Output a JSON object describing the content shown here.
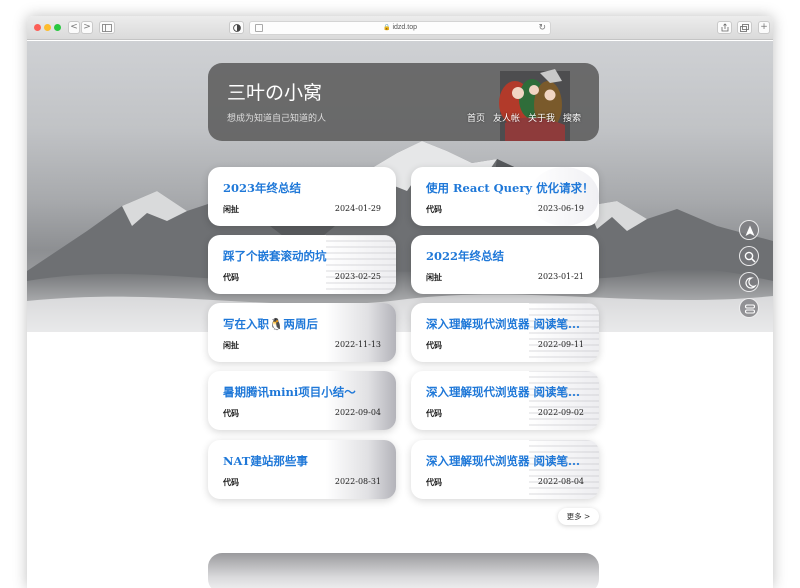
{
  "browser": {
    "url": "idzd.top",
    "nav_back": "<",
    "nav_forward": ">"
  },
  "header": {
    "title": "三叶の小窝",
    "subtitle": "想成为知道自己知道的人",
    "nav": [
      "首页",
      "友人帐",
      "关于我",
      "搜索"
    ]
  },
  "posts": [
    {
      "title": "2023年终总结",
      "category": "闲扯",
      "date": "2024-01-29"
    },
    {
      "title": "使用 React Query 优化请求！",
      "category": "代码",
      "date": "2023-06-19"
    },
    {
      "title": "踩了个嵌套滚动的坑",
      "category": "代码",
      "date": "2023-02-25"
    },
    {
      "title": "2022年终总结",
      "category": "闲扯",
      "date": "2023-01-21"
    },
    {
      "title": "写在入职🐧两周后",
      "category": "闲扯",
      "date": "2022-11-13"
    },
    {
      "title": "深入理解现代浏览器 阅读笔...",
      "category": "代码",
      "date": "2022-09-11"
    },
    {
      "title": "暑期腾讯mini项目小结～",
      "category": "代码",
      "date": "2022-09-04"
    },
    {
      "title": "深入理解现代浏览器 阅读笔...",
      "category": "代码",
      "date": "2022-09-02"
    },
    {
      "title": "NAT建站那些事",
      "category": "代码",
      "date": "2022-08-31"
    },
    {
      "title": "深入理解现代浏览器 阅读笔...",
      "category": "代码",
      "date": "2022-08-04"
    }
  ],
  "more_label": "更多 >",
  "side_tools": [
    "navigation-arrow-icon",
    "search-icon",
    "moon-icon",
    "database-icon"
  ],
  "colors": {
    "accent": "#1f78d8",
    "header_bg": "#5f5f5f"
  }
}
